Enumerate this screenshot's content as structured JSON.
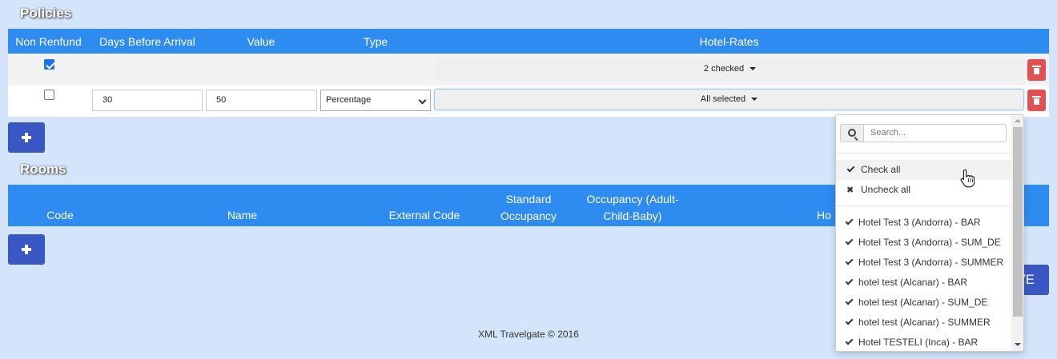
{
  "policies": {
    "title": "Policies",
    "columns": [
      "Non Renfund",
      "Days Before Arrival",
      "Value",
      "Type",
      "Hotel-Rates"
    ],
    "rows": [
      {
        "non_refund": true,
        "hotel_rates": "2 checked"
      },
      {
        "non_refund": false,
        "days_before_arrival": "30",
        "value": "50",
        "type": "Percentage",
        "hotel_rates": "All selected"
      }
    ]
  },
  "rooms": {
    "title": "Rooms",
    "columns": {
      "code": "Code",
      "name": "Name",
      "external_code": "External Code",
      "standard_occupancy": [
        "Standard",
        "Occupancy"
      ],
      "occupancy_acb": [
        "Occupancy (Adult-",
        "Child-Baby)"
      ],
      "partial": "Ho"
    }
  },
  "save_label": "VE",
  "footer": "XML Travelgate © 2016",
  "dropdown": {
    "search_placeholder": "Search...",
    "check_all": "Check all",
    "uncheck_all": "Uncheck all",
    "options": [
      "Hotel Test 3 (Andorra) - BAR",
      "Hotel Test 3 (Andorra) - SUM_DE",
      "Hotel Test 3 (Andorra) - SUMMER",
      "hotel test (Alcanar) - BAR",
      "hotel test (Alcanar) - SUM_DE",
      "hotel test (Alcanar) - SUMMER",
      "Hotel TESTELI (Inca) - BAR"
    ]
  },
  "colors": {
    "background": "#d3e4fb",
    "header": "#2e8bf0",
    "primary_button": "#3a58c4",
    "delete_button": "#e25151"
  }
}
